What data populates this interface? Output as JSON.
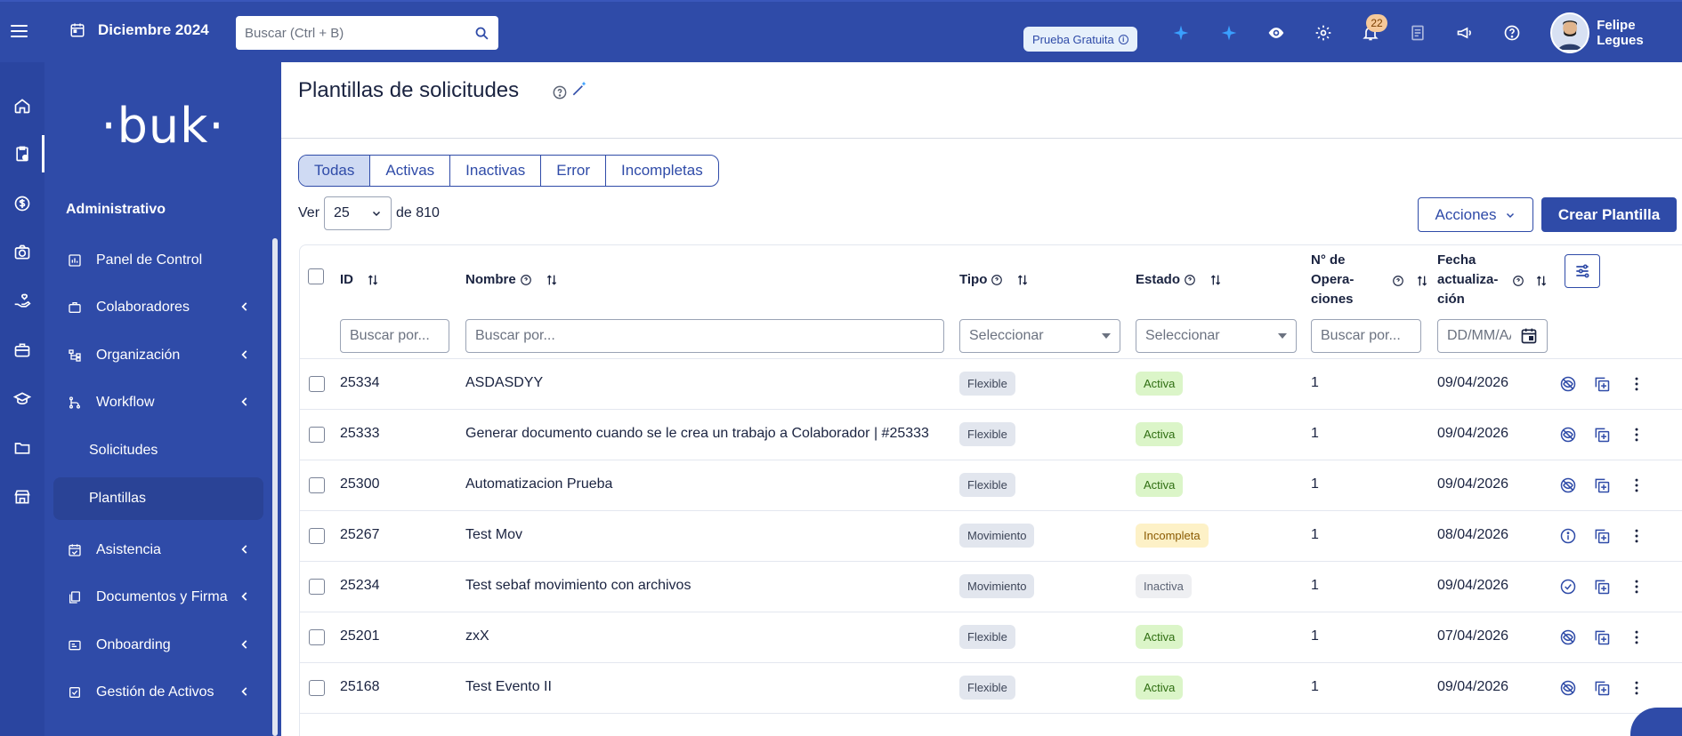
{
  "topbar": {
    "date": "Diciembre 2024",
    "search_placeholder": "Buscar (Ctrl + B)",
    "trial_label": "Prueba Gratuita",
    "notifications_count": "22",
    "user_name": "Felipe Legues",
    "icons": [
      "menu-icon",
      "calendar-icon",
      "search-icon",
      "sparkle-icon",
      "sparkle-icon",
      "eye-icon",
      "gear-icon",
      "bell-icon",
      "document-icon",
      "megaphone-icon",
      "help-icon"
    ]
  },
  "rail": {
    "icons": [
      "home-icon",
      "clipboard-icon",
      "dollar-icon",
      "camera-icon",
      "hand-heart-icon",
      "briefcase-icon",
      "graduation-icon",
      "folder-icon",
      "store-icon"
    ]
  },
  "sidebar": {
    "logo": "·buk·",
    "section_title": "Administrativo",
    "items": [
      {
        "label": "Panel de Control",
        "icon": "dashboard-icon"
      },
      {
        "label": "Colaboradores",
        "icon": "briefcase-icon"
      },
      {
        "label": "Organización",
        "icon": "org-chart-icon"
      },
      {
        "label": "Workflow",
        "icon": "workflow-icon"
      },
      {
        "label": "Solicitudes"
      },
      {
        "label": "Plantillas"
      },
      {
        "label": "Asistencia",
        "icon": "calendar-check-icon"
      },
      {
        "label": "Documentos y Firma",
        "icon": "documents-icon"
      },
      {
        "label": "Onboarding",
        "icon": "id-card-icon"
      },
      {
        "label": "Gestión de Activos",
        "icon": "assets-icon"
      }
    ]
  },
  "main": {
    "page_title": "Plantillas de solicitudes",
    "tabs": [
      "Todas",
      "Activas",
      "Inactivas",
      "Error",
      "Incompletas"
    ],
    "active_tab": "Todas",
    "ver_label": "Ver",
    "page_size": "25",
    "total_label": "de 810",
    "actions_label": "Acciones",
    "create_label": "Crear Plantilla",
    "columns": {
      "id": "ID",
      "nombre": "Nombre",
      "tipo": "Tipo",
      "estado": "Estado",
      "operaciones_l1": "N° de",
      "operaciones_l2": "Opera-",
      "operaciones_l3": "ciones",
      "fecha_l1": "Fecha",
      "fecha_l2": "actualiza-",
      "fecha_l3": "ción"
    },
    "filters": {
      "id_placeholder": "Buscar por...",
      "nombre_placeholder": "Buscar por...",
      "tipo_placeholder": "Seleccionar",
      "estado_placeholder": "Seleccionar",
      "ops_placeholder": "Buscar por...",
      "fecha_placeholder": "DD/MM/AAAA"
    },
    "rows": [
      {
        "id": "25334",
        "nombre": "ASDASDYY",
        "tipo": "Flexible",
        "estado": "Activa",
        "ops": "1",
        "fecha": "09/04/2026",
        "status_icon": "eye-off-icon"
      },
      {
        "id": "25333",
        "nombre": "Generar documento cuando se le crea un trabajo a Colaborador | #25333",
        "tipo": "Flexible",
        "estado": "Activa",
        "ops": "1",
        "fecha": "09/04/2026",
        "status_icon": "eye-off-icon"
      },
      {
        "id": "25300",
        "nombre": "Automatizacion Prueba",
        "tipo": "Flexible",
        "estado": "Activa",
        "ops": "1",
        "fecha": "09/04/2026",
        "status_icon": "eye-off-icon"
      },
      {
        "id": "25267",
        "nombre": "Test Mov",
        "tipo": "Movimiento",
        "estado": "Incompleta",
        "ops": "1",
        "fecha": "08/04/2026",
        "status_icon": "info-icon"
      },
      {
        "id": "25234",
        "nombre": "Test sebaf movimiento con archivos",
        "tipo": "Movimiento",
        "estado": "Inactiva",
        "ops": "1",
        "fecha": "09/04/2026",
        "status_icon": "check-circle-icon"
      },
      {
        "id": "25201",
        "nombre": "zxX",
        "tipo": "Flexible",
        "estado": "Activa",
        "ops": "1",
        "fecha": "07/04/2026",
        "status_icon": "eye-off-icon"
      },
      {
        "id": "25168",
        "nombre": "Test Evento II",
        "tipo": "Flexible",
        "estado": "Activa",
        "ops": "1",
        "fecha": "09/04/2026",
        "status_icon": "eye-off-icon"
      }
    ]
  },
  "colors": {
    "brand": "#2f4ba8",
    "active_badge": "#dbf5c8",
    "incomplete_badge": "#fdf1c7"
  }
}
